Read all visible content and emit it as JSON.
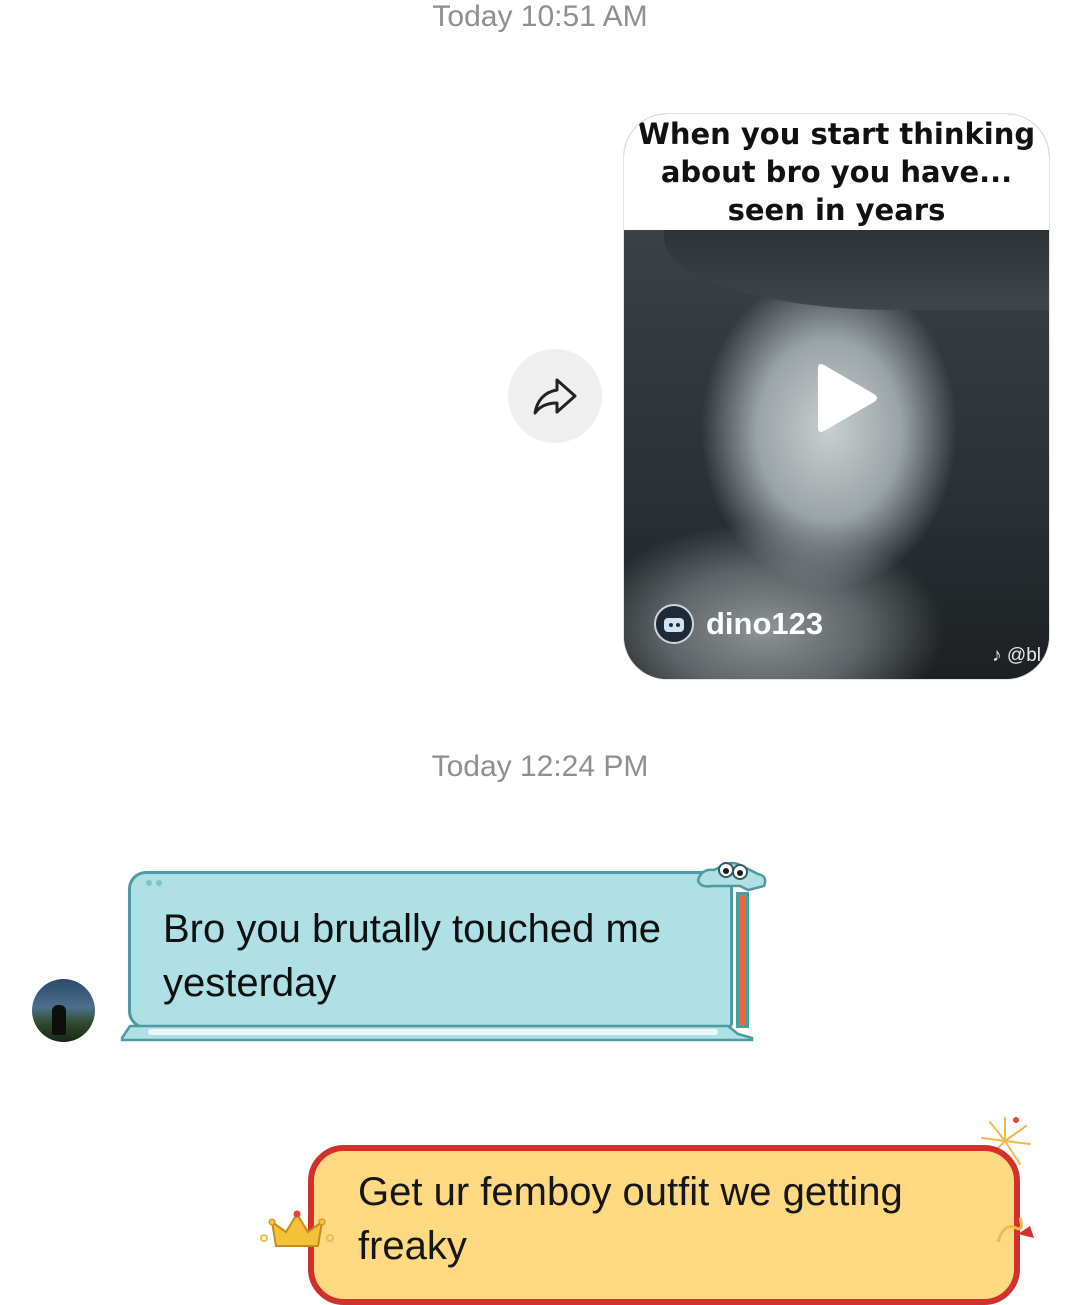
{
  "conversation": {
    "timestamps": [
      "Today 10:51 AM",
      "Today 12:24 PM"
    ]
  },
  "shared_video": {
    "caption": "When you start thinking about bro you have... seen in years",
    "author": "dino123",
    "watermark": "♪ @bl",
    "icons": [
      "play-icon",
      "share-icon",
      "tiktok-logo-icon"
    ]
  },
  "messages": [
    {
      "direction": "incoming",
      "text": "Bro you brutally touched me yesterday",
      "bubble_color": "#aee0e6",
      "border_color": "#4b9ba0"
    },
    {
      "direction": "outgoing",
      "text": "Get ur femboy outfit we getting freaky",
      "bubble_color": "#ffd982",
      "border_color": "#d3302b"
    }
  ],
  "colors": {
    "timestamp": "#8e8e93",
    "share_button_bg": "#efefef"
  }
}
